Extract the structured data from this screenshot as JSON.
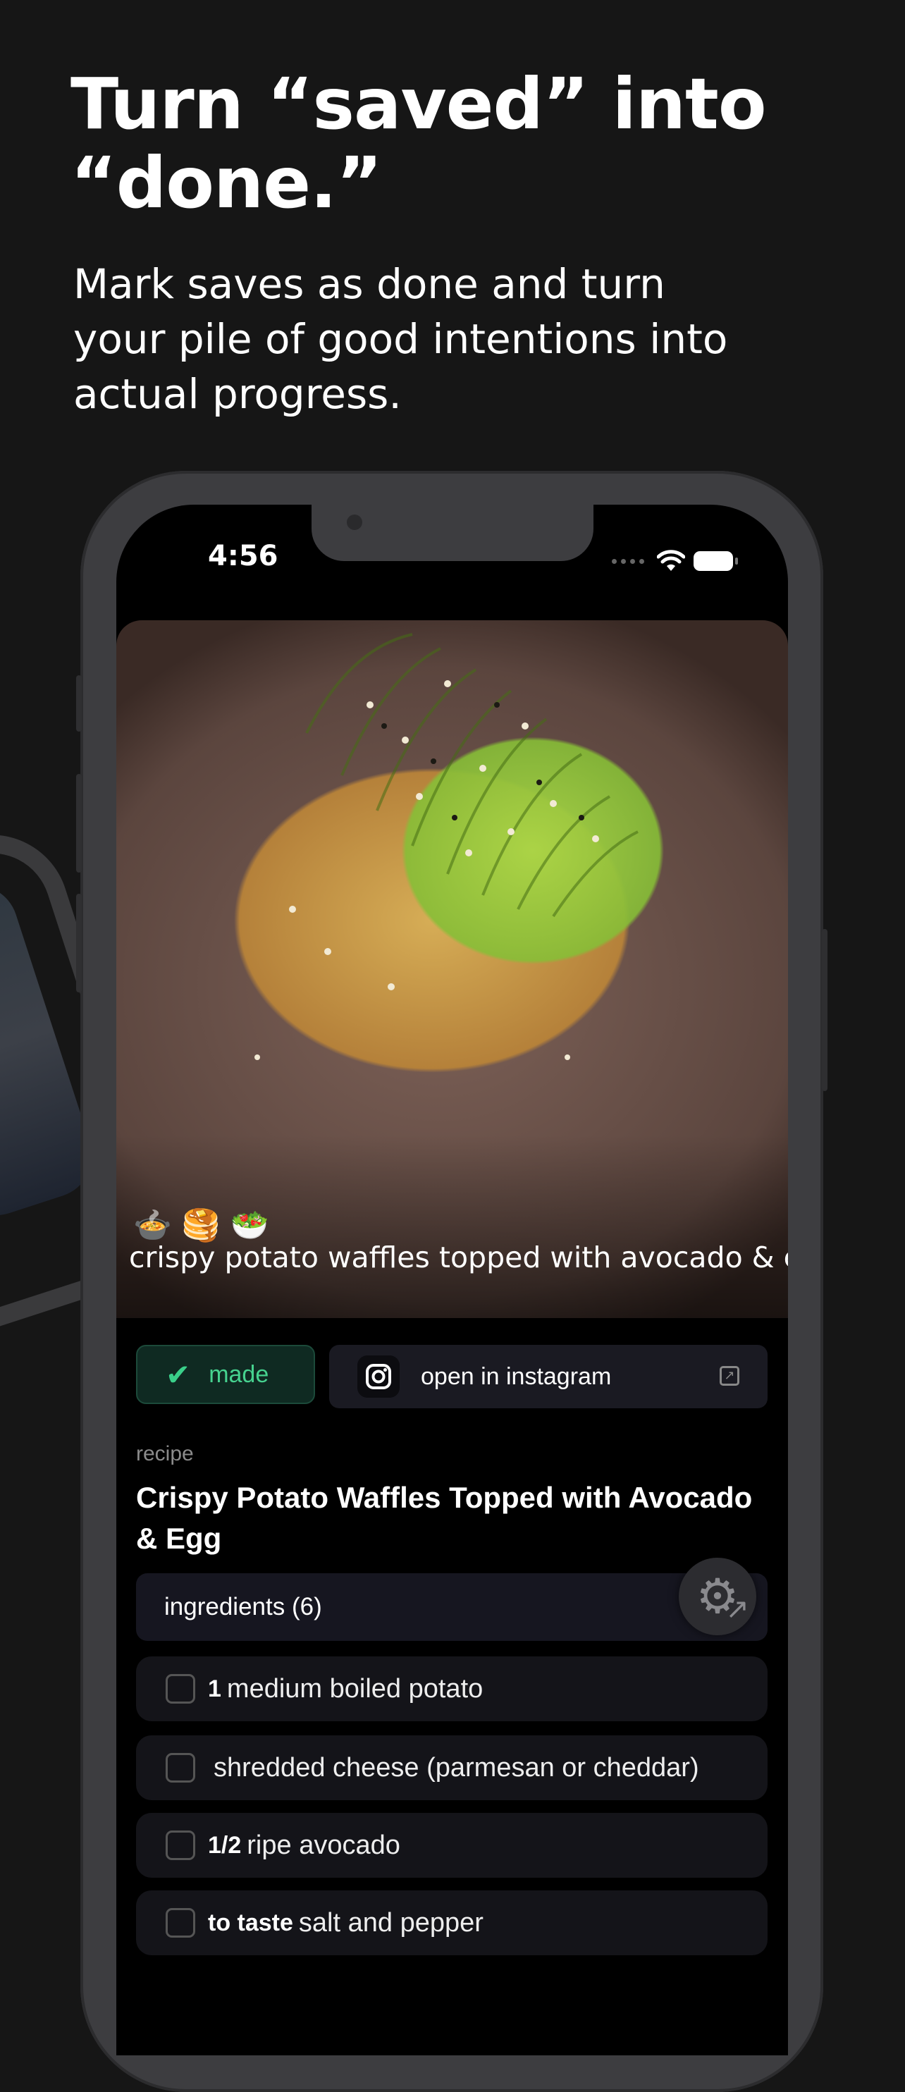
{
  "headline": "Turn “saved” into\n“done.”",
  "subhead": "Mark saves as done and turn your pile of good intentions into actual progress.",
  "status": {
    "time": "4:56"
  },
  "post": {
    "emojis": [
      "🍲",
      "🥞",
      "🥗"
    ],
    "caption": "crispy potato waffles topped with avocado & egg",
    "made_label": "made",
    "open_label": "open in instagram"
  },
  "recipe": {
    "section_label": "recipe",
    "title": "Crispy Potato Waffles Topped with Avocado & Egg",
    "ingredients_header": "ingredients (6)",
    "ingredients": [
      {
        "qty": "1",
        "item": "medium boiled potato"
      },
      {
        "qty": "",
        "item": "shredded cheese (parmesan or cheddar)"
      },
      {
        "qty": "1/2",
        "item": "ripe avocado"
      },
      {
        "qty": "to taste",
        "item": "salt and pepper"
      }
    ]
  },
  "icons": [
    "check-icon",
    "instagram-icon",
    "external-link-icon",
    "gear-icon",
    "expand-arrow-icon",
    "wifi-icon",
    "battery-icon"
  ],
  "colors": {
    "background": "#161616",
    "made_green": "#46d28f",
    "card": "#141419"
  }
}
